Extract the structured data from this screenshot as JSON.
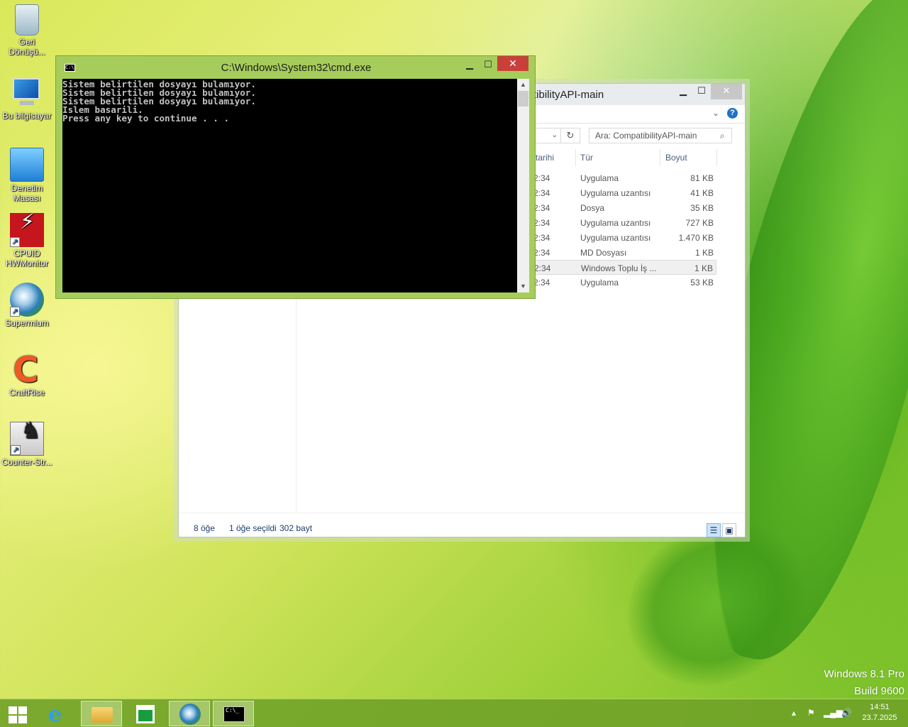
{
  "desktop": {
    "icons": [
      {
        "label": "Geri Dönüşü..."
      },
      {
        "label": "Bu bilgisayar"
      },
      {
        "label": "Denetim Masası"
      },
      {
        "label": "CPUID HWMonitor"
      },
      {
        "label": "Supermium"
      },
      {
        "label": "CraftRise"
      },
      {
        "label": "Counter-Str..."
      }
    ]
  },
  "cmd": {
    "title": "C:\\Windows\\System32\\cmd.exe",
    "lines": [
      "Sistem belirtilen dosyayı bulamıyor.",
      "Sistem belirtilen dosyayı bulamıyor.",
      "Sistem belirtilen dosyayı bulamıyor.",
      "Islem basarili.",
      "Press any key to continue . . ."
    ]
  },
  "explorer": {
    "title_fragment": "tibilityAPI-main",
    "search_placeholder": "Ara: CompatibilityAPI-main",
    "columns": {
      "date": "tarihi",
      "type": "Tür",
      "size": "Boyut"
    },
    "rows": [
      {
        "date": "2:34",
        "type": "Uygulama",
        "size": "81 KB"
      },
      {
        "date": "2:34",
        "type": "Uygulama uzantısı",
        "size": "41 KB"
      },
      {
        "date": "2:34",
        "type": "Dosya",
        "size": "35 KB"
      },
      {
        "date": "2:34",
        "type": "Uygulama uzantısı",
        "size": "727 KB"
      },
      {
        "date": "2:34",
        "type": "Uygulama uzantısı",
        "size": "1.470 KB"
      },
      {
        "date": "2:34",
        "type": "MD Dosyası",
        "size": "1 KB"
      },
      {
        "date": "2:34",
        "type": "Windows Toplu İş ...",
        "size": "1 KB"
      },
      {
        "date": "2:34",
        "type": "Uygulama",
        "size": "53 KB"
      }
    ],
    "status": {
      "count": "8 öğe",
      "selected": "1 öğe seçildi",
      "bytes": "302 bayt"
    }
  },
  "watermark": {
    "line1": "Windows 8.1 Pro",
    "line2": "Build 9600"
  },
  "taskbar": {
    "time": "14:51",
    "date": "23.7.2025"
  },
  "colors": {
    "cmd_frame": "#a6cd5b",
    "cmd_close": "#c9403a",
    "taskbar": "#6ea028"
  }
}
